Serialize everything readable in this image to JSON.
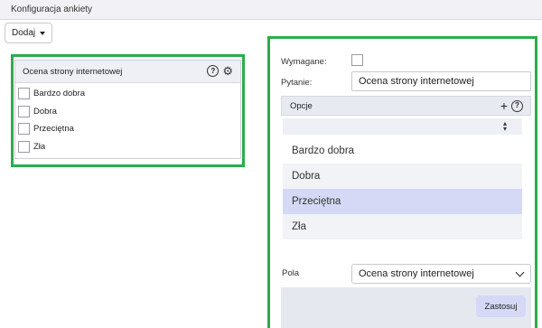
{
  "window": {
    "title": "Konfiguracja ankiety"
  },
  "toolbar": {
    "add_label": "Dodaj"
  },
  "preview": {
    "title": "Ocena strony internetowej",
    "options": [
      {
        "label": "Bardzo dobra",
        "checked": false
      },
      {
        "label": "Dobra",
        "checked": false
      },
      {
        "label": "Przeciętna",
        "checked": false
      },
      {
        "label": "Zła",
        "checked": false
      }
    ]
  },
  "editor": {
    "required_label": "Wymagane:",
    "required_checked": false,
    "question_label": "Pytanie:",
    "question_value": "Ocena strony internetowej",
    "options_header": "Opcje",
    "filter_value": "",
    "options": [
      {
        "label": "Bardzo dobra",
        "selected": false
      },
      {
        "label": "Dobra",
        "selected": false
      },
      {
        "label": "Przeciętna",
        "selected": true
      },
      {
        "label": "Zła",
        "selected": false
      }
    ],
    "field_label": "Pola",
    "field_value": "Ocena strony internetowej",
    "apply_label": "Zastosuj"
  },
  "colors": {
    "highlight_outline": "#2cad4b",
    "selected_row": "#d5d9f5",
    "header_bg": "#eef0f6"
  },
  "icons": [
    "caret-down-icon",
    "help-icon",
    "gear-icon",
    "plus-icon",
    "sort-icon",
    "chevron-down-icon"
  ]
}
